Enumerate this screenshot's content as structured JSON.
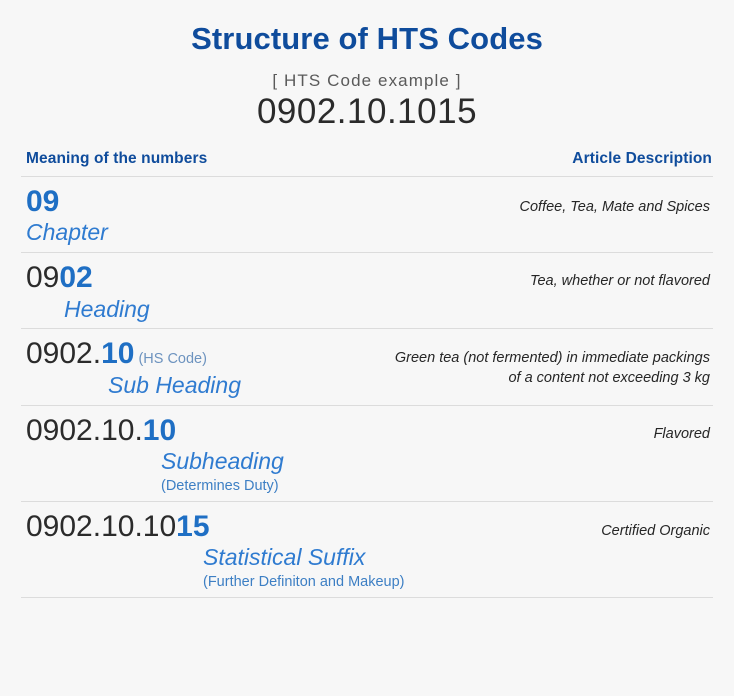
{
  "header": {
    "title": "Structure of HTS Codes",
    "example_label": "[ HTS Code example ]",
    "example_code": "0902.10.1015"
  },
  "columns": {
    "left_header": "Meaning of the numbers",
    "right_header": "Article Description"
  },
  "colors": {
    "title_blue": "#0f4c9c",
    "highlight_blue": "#1f6fc4",
    "meaning_blue": "#2f7bd0",
    "note_blue": "#6d93bf",
    "code_dark": "#2b2b2b",
    "divider": "#dcdcdc",
    "background": "#f7f7f7"
  },
  "rows": [
    {
      "code_dim": "",
      "code_highlight": "09",
      "code_note": "",
      "meaning": "Chapter",
      "meaning_note": "",
      "description": "Coffee, Tea, Mate and Spices"
    },
    {
      "code_dim": "09",
      "code_highlight": "02",
      "code_note": "",
      "meaning": "Heading",
      "meaning_note": "",
      "description": "Tea, whether or not flavored"
    },
    {
      "code_dim": "0902.",
      "code_highlight": "10",
      "code_note": "(HS Code)",
      "meaning": "Sub Heading",
      "meaning_note": "",
      "description": "Green tea (not fermented) in immediate packings of a content not exceeding 3 kg"
    },
    {
      "code_dim": "0902.10.",
      "code_highlight": "10",
      "code_note": "",
      "meaning": "Subheading",
      "meaning_note": "(Determines Duty)",
      "description": "Flavored"
    },
    {
      "code_dim": "0902.10.10",
      "code_highlight": "15",
      "code_note": "",
      "meaning": "Statistical Suffix",
      "meaning_note": "(Further Definiton and Makeup)",
      "description": "Certified Organic"
    }
  ]
}
